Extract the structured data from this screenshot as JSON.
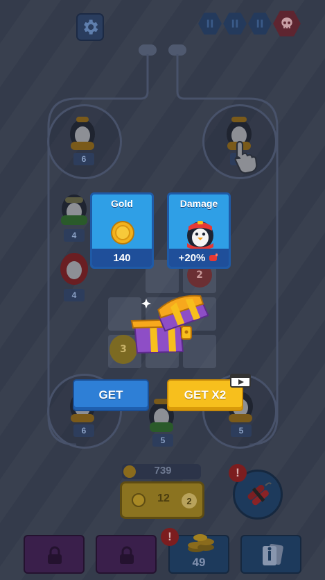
{
  "colors": {
    "accent_blue": "#2e7fd6",
    "accent_yellow": "#f7bf1d",
    "card_blue": "#2f9fe6",
    "alert_red": "#e53935"
  },
  "top_bar": {
    "settings_icon": "gear-icon",
    "wave_indicators": 3,
    "boss_icon": "skull-icon"
  },
  "board": {
    "slots": [
      {
        "id": "top-left",
        "level": "6"
      },
      {
        "id": "top-right",
        "level": "6"
      },
      {
        "id": "left-1",
        "level": "4"
      },
      {
        "id": "left-2",
        "level": "4"
      },
      {
        "id": "bottom-left",
        "level": "6"
      },
      {
        "id": "bottom-center",
        "level": "5"
      },
      {
        "id": "bottom-right",
        "level": "5"
      }
    ],
    "tile_values": [
      "2",
      "3"
    ]
  },
  "reward_popup": {
    "cards": [
      {
        "title": "Gold",
        "value": "140",
        "icon": "coin-icon"
      },
      {
        "title": "Damage",
        "value": "+20%",
        "icon": "penguin-icon"
      }
    ],
    "chest_icon": "treasure-chest-icon",
    "get_label": "GET",
    "get_x2_label": "GET X2",
    "video_icon": "video-ad-icon"
  },
  "wallet": {
    "coins": "739"
  },
  "buy_panel": {
    "cost": "12",
    "count": "2"
  },
  "bomb": {
    "icon": "dynamite-icon",
    "alert": "!"
  },
  "bottom_bar": {
    "slots": [
      {
        "id": "locked-1",
        "icon": "lock-icon"
      },
      {
        "id": "locked-2",
        "icon": "lock-icon"
      },
      {
        "id": "coins",
        "value": "49",
        "alert": "!",
        "icon": "coin-stack-icon"
      },
      {
        "id": "info",
        "icon": "info-cards-icon"
      }
    ]
  }
}
